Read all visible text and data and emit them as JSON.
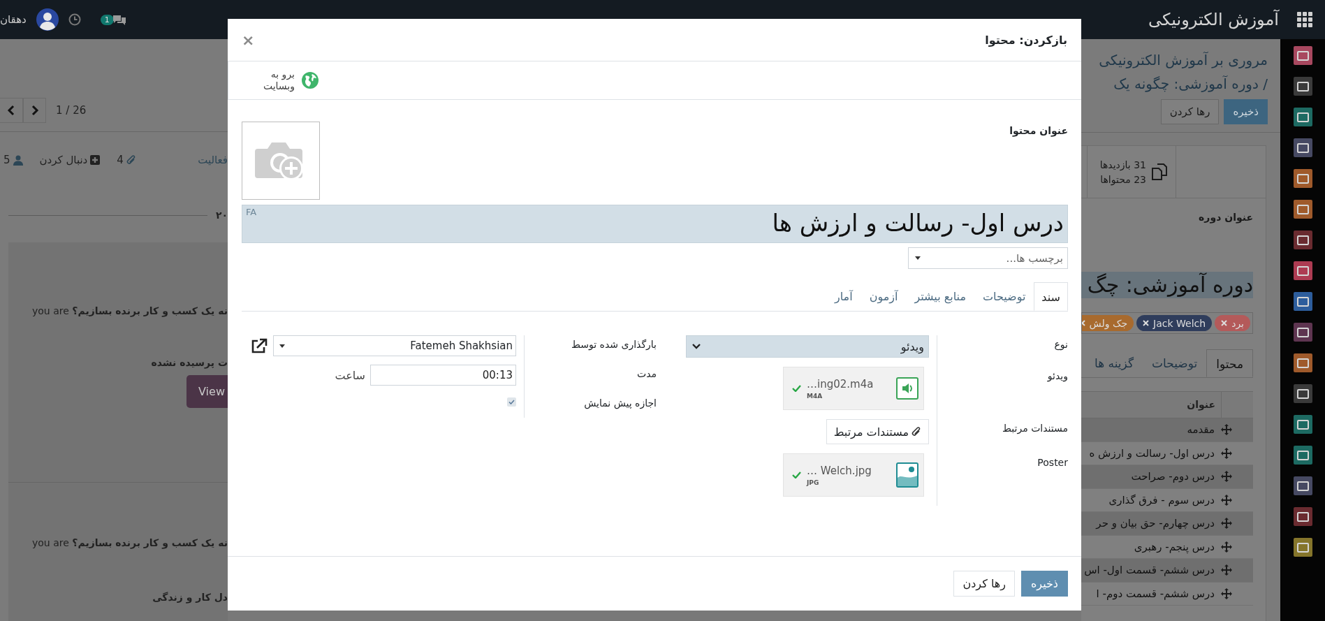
{
  "navbar": {
    "app_title": "آموزش الکترونیکی",
    "user_name": "دهقان",
    "chat_badge": "1"
  },
  "background": {
    "pager": "1 / 26",
    "chatter": {
      "followers": "5",
      "follow": "دنبال کردن",
      "attachments": "4",
      "activity": "فعالیت"
    },
    "date_separator": "۲۰",
    "messages": [
      {
        "text": "**نه یک کسب و کار برنده بسازیم؟** you are",
        "note": "ت پرسیده نشده",
        "button": "View"
      },
      {
        "text": "**نه یک کسب و کار برنده بسازیم؟** you are",
        "note": "دل کار و زندگی"
      }
    ],
    "breadcrumb": [
      "مروری بر آموزش الکترونیکی",
      "/ دوره آموزشی: چگونه یک"
    ],
    "buttons": [
      {
        "label": "ذخیره",
        "kind": "primary"
      },
      {
        "label": "رها کردن",
        "kind": "secondary"
      }
    ],
    "stats": [
      "31 بازدیدها",
      "23 محتواها"
    ],
    "course_title_label": "عنوان دوره",
    "course_title": "دوره آموزشی: چگ",
    "tags": [
      {
        "label": "برد",
        "color": "#b45a5a"
      },
      {
        "label": "Jack Welch",
        "color": "#2f3d5c"
      },
      {
        "label": "جک ولش",
        "color": "#a86a2e"
      }
    ],
    "tabs": [
      {
        "label": "محتوا",
        "selected": true
      },
      {
        "label": "توضیحات",
        "selected": false
      },
      {
        "label": "گزینه ها",
        "selected": false
      }
    ],
    "table": {
      "columns": [
        "عنوان"
      ],
      "rows": [
        {
          "title": "مقدمه"
        },
        {
          "title": "درس اول- رسالت و ارزش ه"
        },
        {
          "title": "درس دوم- صراحت"
        },
        {
          "title": "درس سوم - فرق گذاری"
        },
        {
          "title": "درس چهارم- حق بیان و حر"
        },
        {
          "title": "درس پنجم- رهبری"
        },
        {
          "title": "درس ششم- قسمت اول- اس"
        },
        {
          "title": "درس ششم- قسمت دوم- ا"
        }
      ]
    }
  },
  "app_sidebar": [
    {
      "color": "#a8485f"
    },
    {
      "color": "#3a3a3a"
    },
    {
      "color": "#1d6a62"
    },
    {
      "color": "#464962"
    },
    {
      "color": "#9f5a2b"
    },
    {
      "color": "#9f5a2b"
    },
    {
      "color": "#6a2b30"
    },
    {
      "color": "#ad3b52"
    },
    {
      "color": "#2d5d9c"
    },
    {
      "color": "#5e3550"
    },
    {
      "color": "#9f5a2b"
    },
    {
      "color": "#3a3a3a"
    },
    {
      "color": "#1d6a62"
    },
    {
      "color": "#1d6a62"
    },
    {
      "color": "#464962"
    },
    {
      "color": "#6a2b30"
    },
    {
      "color": "#85752b"
    }
  ],
  "dialog": {
    "title": "بازکردن: محتوا",
    "close": "×",
    "smart_button": "برو به وبسایت",
    "name_label": "عنوان محتوا",
    "name_value": "درس اول- رسالت و ارزش ها",
    "lang_badge": "FA",
    "tags_placeholder": "برچسب ها...",
    "tabs": [
      {
        "label": "سند",
        "selected": true
      },
      {
        "label": "توضیحات",
        "selected": false
      },
      {
        "label": "منابع بیشتر",
        "selected": false
      },
      {
        "label": "آزمون",
        "selected": false
      },
      {
        "label": "آمار",
        "selected": false
      }
    ],
    "right_group": [
      {
        "kind": "select",
        "label": "نوع",
        "value": "ویدئو"
      },
      {
        "kind": "audio_file",
        "label": "ویدئو",
        "file_name": "…ing02.m4a",
        "file_type": "M4A",
        "uploaded": true
      },
      {
        "kind": "button",
        "label": "مستندات مرتبط",
        "value": "مستندات مرتبط"
      },
      {
        "kind": "image_file",
        "label": "Poster",
        "file_name": "… Welch.jpg",
        "file_type": "JPG",
        "uploaded": true
      }
    ],
    "left_group": [
      {
        "kind": "many2one",
        "label": "بارگذاری شده توسط",
        "value": "Fatemeh Shakhsian"
      },
      {
        "kind": "duration",
        "label": "مدت",
        "value": "00:13",
        "unit": "ساعت"
      },
      {
        "kind": "checkbox",
        "label": "اجازه پیش نمایش",
        "checked": true
      }
    ],
    "footer_buttons": [
      {
        "label": "ذخیره",
        "kind": "primary"
      },
      {
        "label": "رها کردن",
        "kind": "secondary"
      }
    ]
  }
}
